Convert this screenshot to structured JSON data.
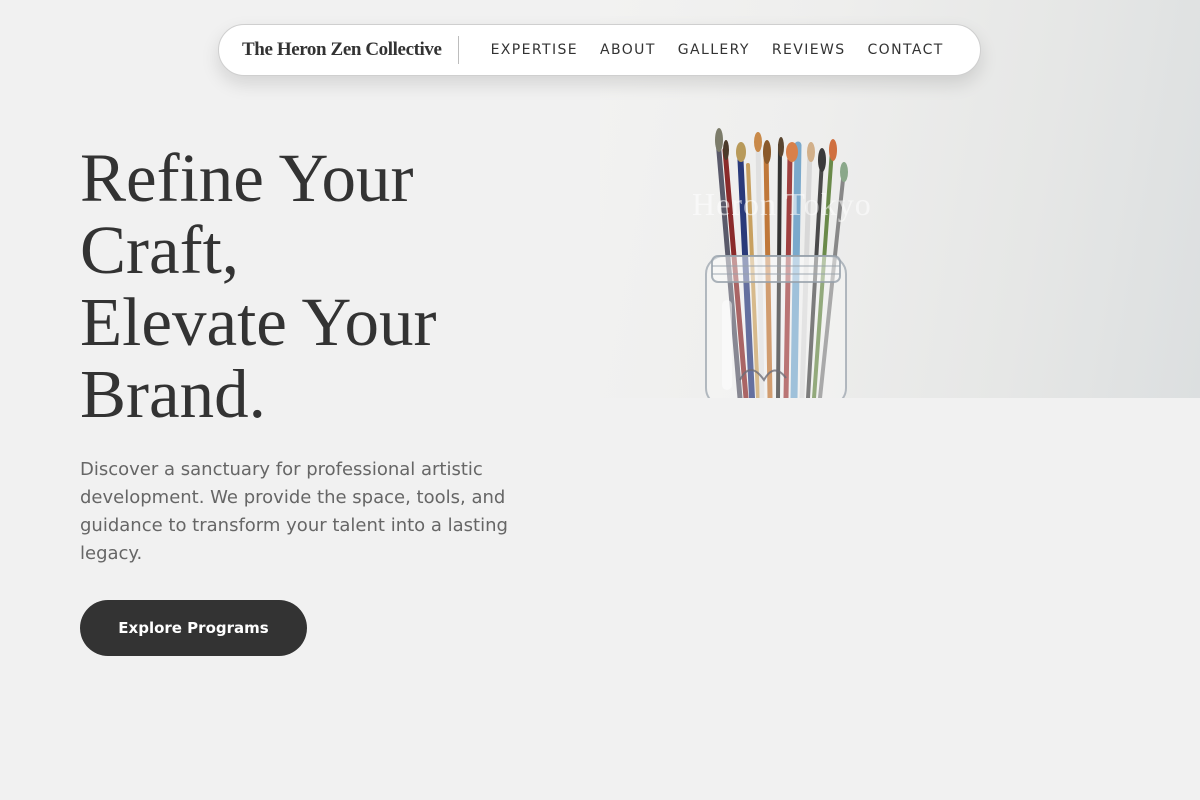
{
  "nav": {
    "brand": "The Heron Zen Collective",
    "links": [
      "EXPERTISE",
      "ABOUT",
      "GALLERY",
      "REVIEWS",
      "CONTACT"
    ]
  },
  "hero": {
    "title_lines": [
      "Refine Your",
      "Craft,",
      "Elevate Your",
      "Brand."
    ],
    "description": "Discover a sanctuary for professional artistic development. We provide the space, tools, and guidance to transform your talent into a lasting legacy.",
    "cta_label": "Explore Programs",
    "image_overlay_text": "Heron Tokyo"
  },
  "colors": {
    "background": "#f1f1f1",
    "text_primary": "#333333",
    "text_secondary": "#666666",
    "button_bg": "#333333",
    "button_text": "#ffffff"
  }
}
